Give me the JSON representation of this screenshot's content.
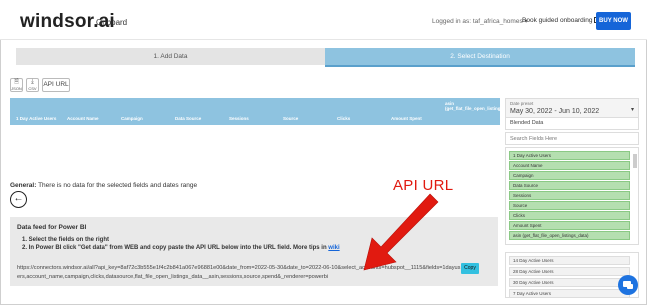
{
  "header": {
    "logo": "windsor.ai",
    "section": "Onboard",
    "logged_in": "Logged in as: taf_africa_homes ▾",
    "guided": "Book guided onboarding",
    "buy": "BUY NOW"
  },
  "steps": {
    "step1": "1. Add Data",
    "step2": "2. Select Destination"
  },
  "toolbar": {
    "json_label": "JSON",
    "csv_label": "CSV",
    "api_label": "API URL"
  },
  "table": {
    "columns": [
      "1 Day Active Users",
      "Account Name",
      "Campaign",
      "Data Source",
      "Sessions",
      "Source",
      "Clicks",
      "Amount Spent"
    ],
    "last_column": "asin (get_flat_file_open_listings_data)"
  },
  "general": {
    "prefix": "General:",
    "text": "There is no data for the selected fields and dates range"
  },
  "annotation": "API URL",
  "feed": {
    "title": "Data feed for Power BI",
    "step1": "1. Select the fields on the right",
    "step2_text": "2. In Power BI click \"Get data\" from WEB and copy paste the API URL below into the URL field. More tips in",
    "step2_link": "wiki",
    "url": "https://connectors.windsor.ai/all?api_key=8af72c3b555e1f4c2b841a067e96881e00&date_from=2022-05-30&date_to=2022-06-10&select_accounts=hubspot__1115&fields=1dayusers,account_name,campaign,clicks,datasource,flat_file_open_listings_data__asin,sessions,source,spend&_renderer=powerbi",
    "copy": "Copy"
  },
  "panel": {
    "date_label": "Date preset",
    "date_value": "May 30, 2022 - Jun 10, 2022",
    "blended": "Blended Data",
    "search_placeholder": "Search Fields Here",
    "selected": [
      "1 Day Active Users",
      "Account Name",
      "Campaign",
      "Data Source",
      "Sessions",
      "Source",
      "Clicks",
      "Amount Spent",
      "asin (get_flat_file_open_listings_data)"
    ],
    "available": [
      "14 Day Active Users",
      "28 Day Active Users",
      "30 Day Active Users",
      "7 Day Active Users"
    ]
  },
  "colors": {
    "accent": "#8ec3e0",
    "buy": "#1565d8",
    "annotation": "#e11a10",
    "selected_field": "#b5dfb0"
  }
}
